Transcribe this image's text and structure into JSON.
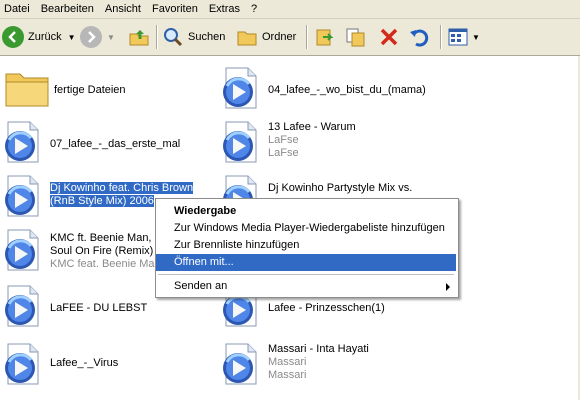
{
  "menu": [
    "Datei",
    "Bearbeiten",
    "Ansicht",
    "Favoriten",
    "Extras",
    "?"
  ],
  "toolbar": {
    "back_label": "Zurück",
    "search_label": "Suchen",
    "folders_label": "Ordner"
  },
  "files": [
    {
      "name": "fertige Dateien",
      "icon": "folder-icon",
      "lines": []
    },
    {
      "name": "04_lafee_-_wo_bist_du_(mama)",
      "icon": "media-file-icon",
      "lines": []
    },
    {
      "name": "07_lafee_-_das_erste_mal",
      "icon": "media-file-icon",
      "lines": []
    },
    {
      "name": "13 Lafee - Warum",
      "icon": "media-file-icon",
      "lines": [
        "LaFse",
        "LaFse"
      ]
    },
    {
      "name_lines": [
        "Dj Kowinho feat. Chris Brown",
        "(RnB Style Mix) 2006"
      ],
      "icon": "media-file-icon",
      "lines": []
    },
    {
      "name_lines": [
        "Dj Kowinho Partystyle Mix vs."
      ],
      "icon": "media-file-icon",
      "lines": []
    },
    {
      "name_lines": [
        "KMC ft. Beenie Man,",
        "Soul On Fire (Remix)"
      ],
      "icon": "media-file-icon",
      "lines": [
        "KMC feat. Beenie Man"
      ]
    },
    {
      "name": "LaFEE - DU LEBST",
      "icon": "media-file-icon",
      "lines": []
    },
    {
      "name": "Lafee - Prinzesschen(1)",
      "icon": "media-file-icon",
      "lines": []
    },
    {
      "name": "Lafee_-_Virus",
      "icon": "media-file-icon",
      "lines": []
    },
    {
      "name": "Massari - Inta Hayati",
      "icon": "media-file-icon",
      "lines": [
        "Massari",
        "Massari"
      ]
    }
  ],
  "context_menu": {
    "items": [
      {
        "label": "Wiedergabe",
        "bold": true
      },
      {
        "label": "Zur Windows Media Player-Wiedergabeliste hinzufügen"
      },
      {
        "label": "Zur Brennliste hinzufügen"
      },
      {
        "label": "Öffnen mit...",
        "selected": true
      },
      {
        "label": "Senden an",
        "submenu": true
      }
    ]
  },
  "colors": {
    "selection": "#316ac5",
    "chrome": "#ece9d8",
    "subtext": "#8a8a8a"
  }
}
